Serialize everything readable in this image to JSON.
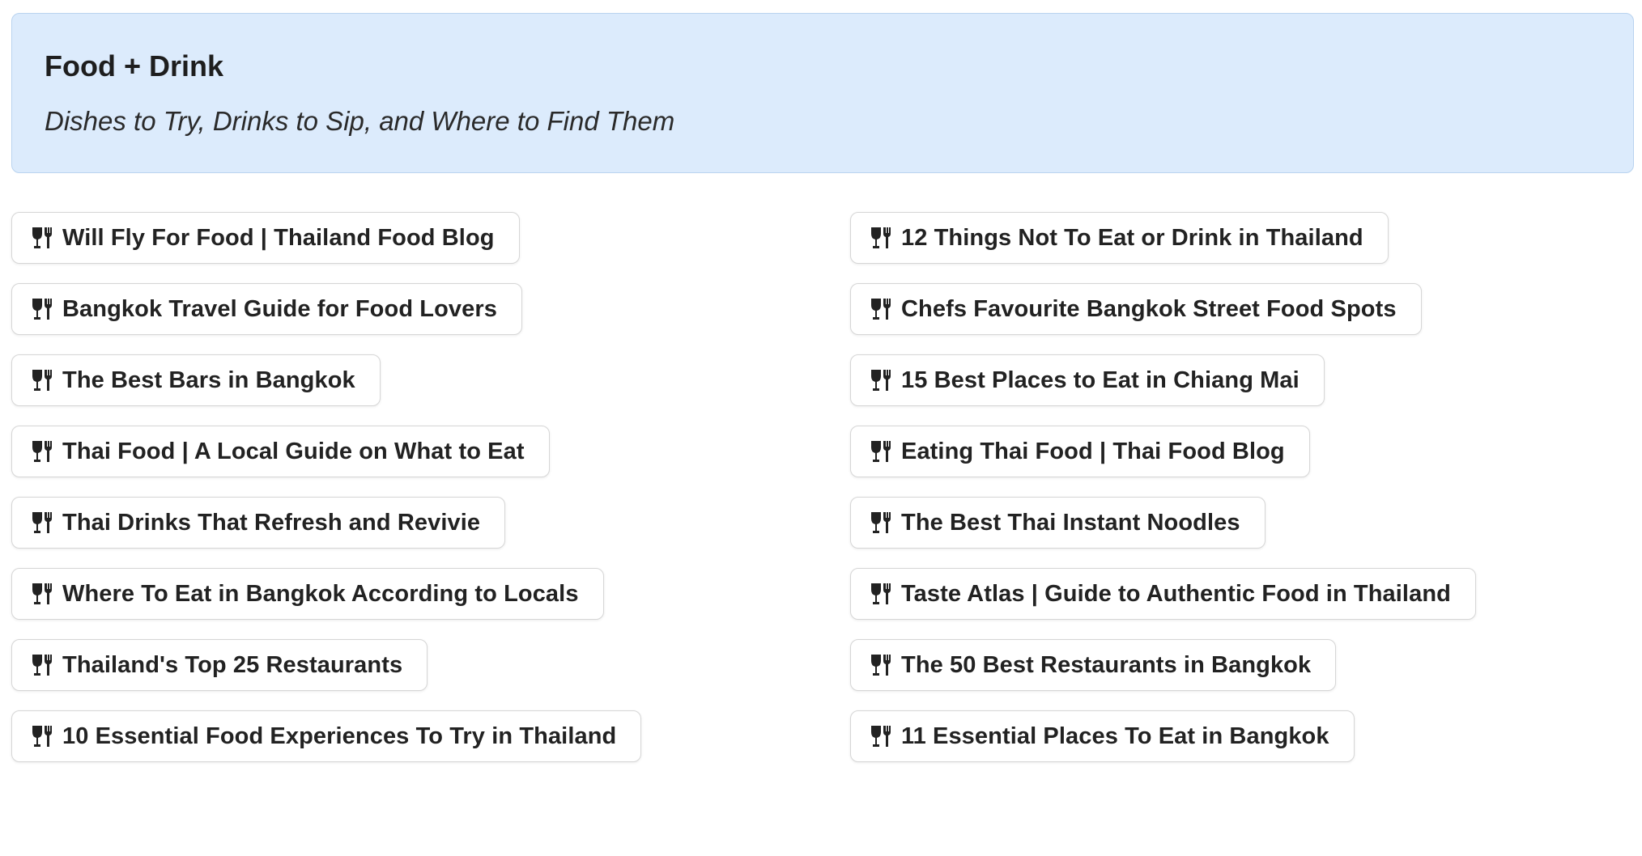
{
  "header": {
    "title": "Food + Drink",
    "subtitle": "Dishes to Try, Drinks to Sip, and Where to Find Them"
  },
  "links": {
    "icon": "fork-and-glass-icon",
    "left": [
      {
        "label": "Will Fly For Food | Thailand Food Blog"
      },
      {
        "label": "Bangkok Travel Guide for Food Lovers"
      },
      {
        "label": "The Best Bars in Bangkok"
      },
      {
        "label": "Thai Food | A Local Guide on What to Eat"
      },
      {
        "label": "Thai Drinks That Refresh and Revivie"
      },
      {
        "label": "Where To Eat in Bangkok According to Locals"
      },
      {
        "label": "Thailand's Top 25 Restaurants"
      },
      {
        "label": "10 Essential Food Experiences To Try in Thailand"
      }
    ],
    "right": [
      {
        "label": "12 Things Not To Eat or Drink in Thailand"
      },
      {
        "label": "Chefs Favourite Bangkok Street Food Spots"
      },
      {
        "label": "15 Best Places to Eat in Chiang Mai"
      },
      {
        "label": "Eating Thai Food | Thai Food Blog"
      },
      {
        "label": "The Best Thai Instant Noodles"
      },
      {
        "label": "Taste Atlas | Guide to Authentic Food in Thailand"
      },
      {
        "label": "The 50 Best Restaurants in Bangkok"
      },
      {
        "label": "11 Essential Places To Eat in Bangkok"
      }
    ]
  },
  "colors": {
    "header_bg": "#dcebfc",
    "header_border": "#b9d3ef",
    "text": "#222222",
    "button_border": "#d6d6d6"
  }
}
